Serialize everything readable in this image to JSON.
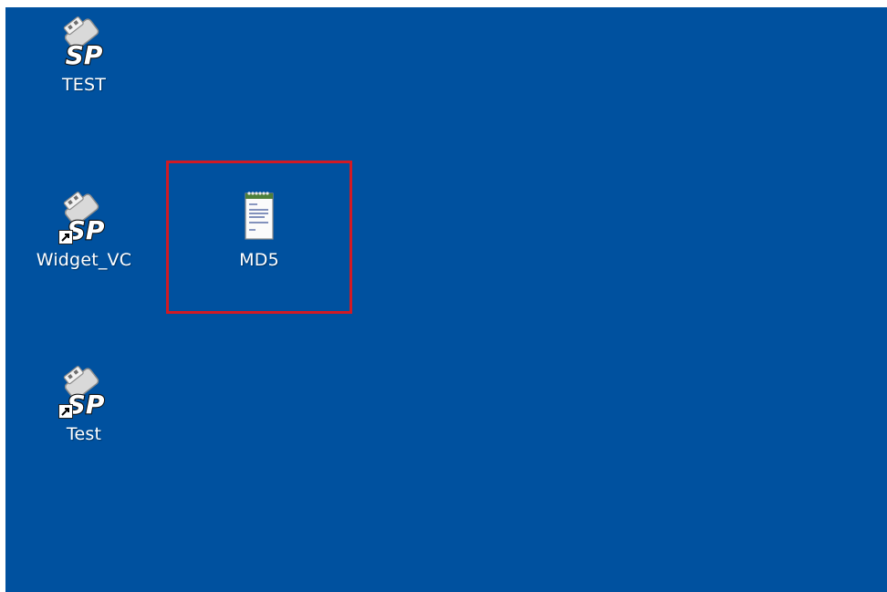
{
  "desktop": {
    "background_color": "#00519f",
    "icons": [
      {
        "label": "TEST",
        "icon": "sp-usb-app-icon",
        "shortcut": false
      },
      {
        "label": "Widget_VC",
        "icon": "sp-usb-app-icon",
        "shortcut": true
      },
      {
        "label": "MD5",
        "icon": "notepad-text-file-icon",
        "shortcut": false,
        "highlighted": true
      },
      {
        "label": "Test",
        "icon": "sp-usb-app-icon",
        "shortcut": true
      }
    ],
    "highlight_color": "#d11a24"
  }
}
